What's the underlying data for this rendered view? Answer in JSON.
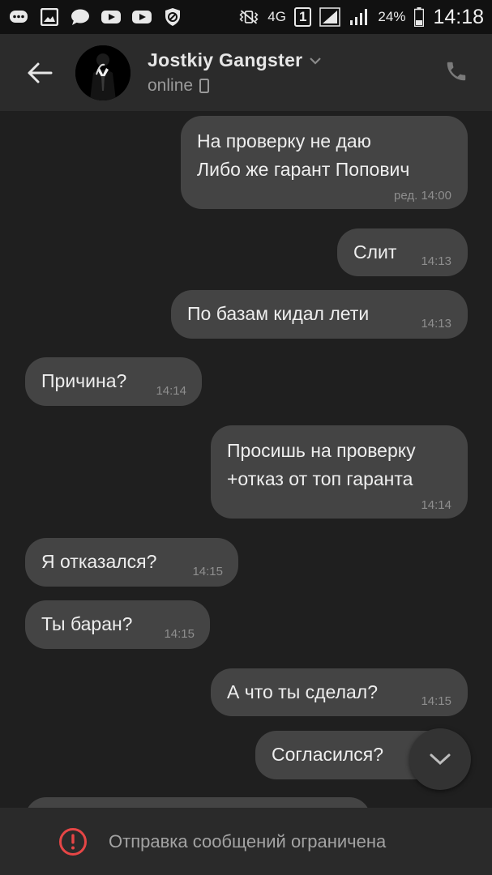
{
  "status_bar": {
    "network": "4G",
    "sim": "1",
    "battery": "24%",
    "time": "14:18",
    "icons": [
      "chat-icon",
      "gallery-icon",
      "message-icon",
      "youtube-icon",
      "youtube-icon",
      "blocked-icon",
      "vibrate-icon",
      "signal-icon",
      "battery-icon"
    ]
  },
  "header": {
    "name": "Jostkiy Gangster",
    "status": "online"
  },
  "messages": [
    {
      "side": "out",
      "text": "На проверку не даю\nЛибо же гарант Попович",
      "time": "ред. 14:00"
    },
    {
      "side": "out",
      "text": "Слит",
      "time": "14:13"
    },
    {
      "side": "out",
      "text": "По базам кидал лети",
      "time": "14:13"
    },
    {
      "side": "in",
      "text": "Причина?",
      "time": "14:14"
    },
    {
      "side": "out",
      "text": "Просишь на проверку\n+отказ от топ гаранта",
      "time": "14:14"
    },
    {
      "side": "in",
      "text": "Я отказался?",
      "time": "14:15"
    },
    {
      "side": "in",
      "text": "Ты баран?",
      "time": "14:15"
    },
    {
      "side": "out",
      "text": "А что ты сделал?",
      "time": "14:15"
    },
    {
      "side": "out",
      "text": "Согласился?",
      "time": ""
    }
  ],
  "bottom": {
    "restriction_text": "Отправка сообщений ограничена"
  },
  "colors": {
    "background": "#1f1f1f",
    "header": "#2b2b2b",
    "bubble": "#444444",
    "warning": "#e64646"
  }
}
